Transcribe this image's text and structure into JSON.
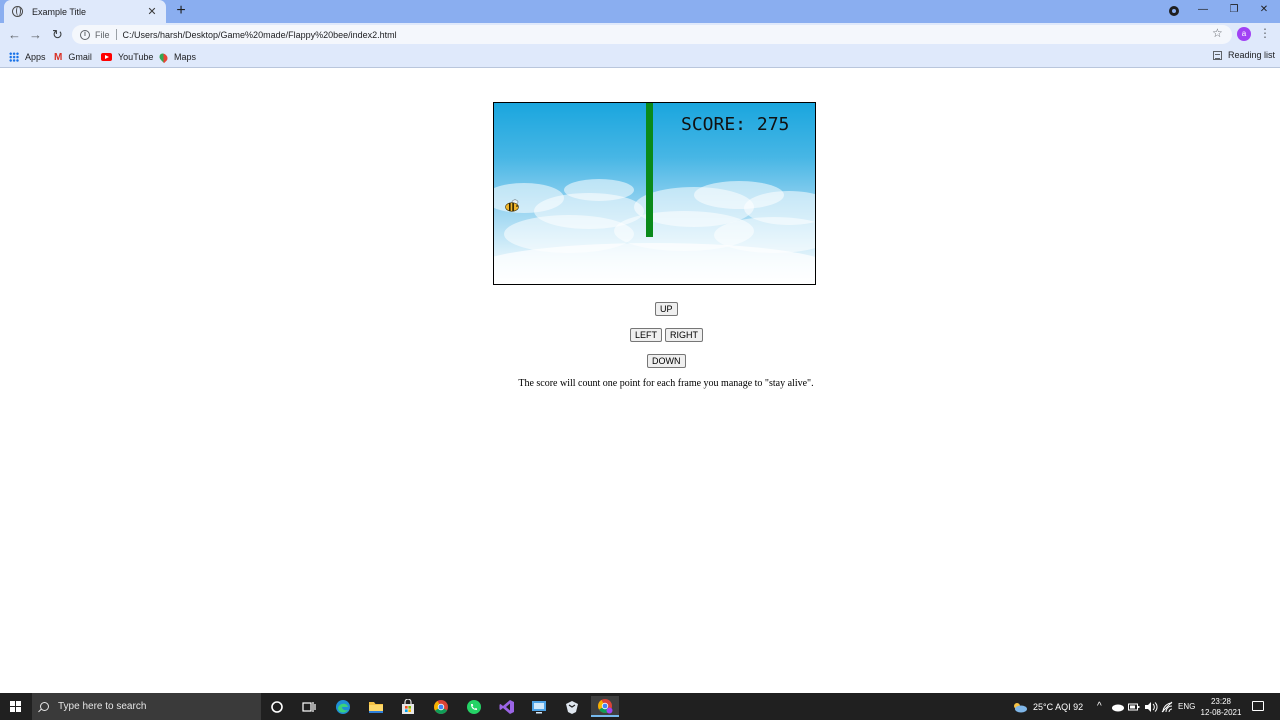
{
  "browser": {
    "tab_title": "Example Title",
    "tab_close": "✕",
    "new_tab": "+",
    "window_minimize": "—",
    "window_restore": "❐",
    "window_close": "✕",
    "back": "←",
    "forward": "→",
    "reload": "↻",
    "info_glyph": "i",
    "file_label": "File",
    "url": "C:/Users/harsh/Desktop/Game%20made/Flappy%20bee/index2.html",
    "star": "☆",
    "profile_initial": "a",
    "menu": "⋮",
    "bookmarks": [
      {
        "label": "Apps",
        "icon": "apps-icon"
      },
      {
        "label": "Gmail",
        "icon": "gmail-icon",
        "glyph": "M"
      },
      {
        "label": "YouTube",
        "icon": "youtube-icon"
      },
      {
        "label": "Maps",
        "icon": "maps-icon"
      }
    ],
    "reading_list": "Reading list",
    "colors": {
      "tab_strip": "#8aaef0",
      "toolbar": "#dfe9fb",
      "profile": "#a142f4"
    }
  },
  "game": {
    "score_text": "SCORE: 275",
    "controls": {
      "up": "UP",
      "left": "LEFT",
      "right": "RIGHT",
      "down": "DOWN"
    },
    "instructions": "The score will count one point for each frame you manage to \"stay alive\".",
    "colors": {
      "sky_top": "#1aa6de",
      "pipe": "#0a8a1a",
      "bee": "#f2b72b"
    }
  },
  "taskbar": {
    "search_placeholder": "Type here to search",
    "apps": [
      {
        "name": "cortana-icon"
      },
      {
        "name": "task-view-icon"
      },
      {
        "name": "edge-icon"
      },
      {
        "name": "file-explorer-icon"
      },
      {
        "name": "store-icon"
      },
      {
        "name": "chrome-icon"
      },
      {
        "name": "whatsapp-icon"
      },
      {
        "name": "visual-studio-icon"
      },
      {
        "name": "remote-desktop-icon"
      },
      {
        "name": "terminal-icon"
      },
      {
        "name": "chrome-profile-icon"
      }
    ],
    "weather": "25°C  AQI 92",
    "language": "ENG",
    "time": "23:28",
    "date": "12-08-2021"
  }
}
